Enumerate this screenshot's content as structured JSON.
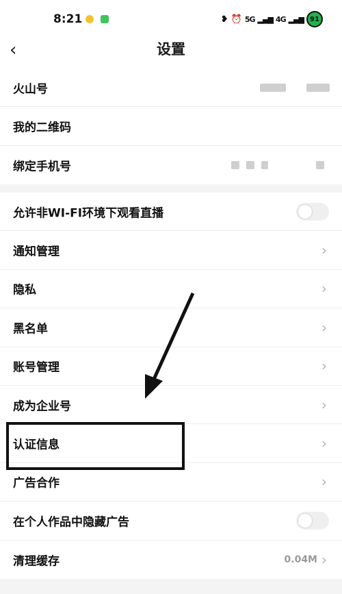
{
  "status_bar": {
    "time": "8:21",
    "network_5g": "5G",
    "network_4g": "4G",
    "battery_level": "91",
    "colors": {
      "battery": "#22b14c"
    }
  },
  "header": {
    "title": "设置",
    "back_icon": "chevron-left-icon"
  },
  "account_section": [
    {
      "label": "火山号"
    },
    {
      "label": "我的二维码"
    },
    {
      "label": "绑定手机号"
    }
  ],
  "settings_section": [
    {
      "label": "允许非WI-FI环境下观看直播",
      "control": "toggle",
      "on": false
    },
    {
      "label": "通知管理",
      "control": "chevron"
    },
    {
      "label": "隐私",
      "control": "chevron"
    },
    {
      "label": "黑名单",
      "control": "chevron"
    },
    {
      "label": "账号管理",
      "control": "chevron"
    },
    {
      "label": "成为企业号",
      "control": "chevron"
    },
    {
      "label": "认证信息",
      "control": "chevron",
      "highlighted": true
    },
    {
      "label": "广告合作",
      "control": "chevron"
    },
    {
      "label": "在个人作品中隐藏广告",
      "control": "toggle",
      "on": false
    },
    {
      "label": "清理缓存",
      "control": "chevron",
      "value": "0.04M"
    }
  ],
  "icons": {
    "chevron": "chevron-right-icon",
    "annotation_arrow": "arrow-down-left-icon"
  }
}
